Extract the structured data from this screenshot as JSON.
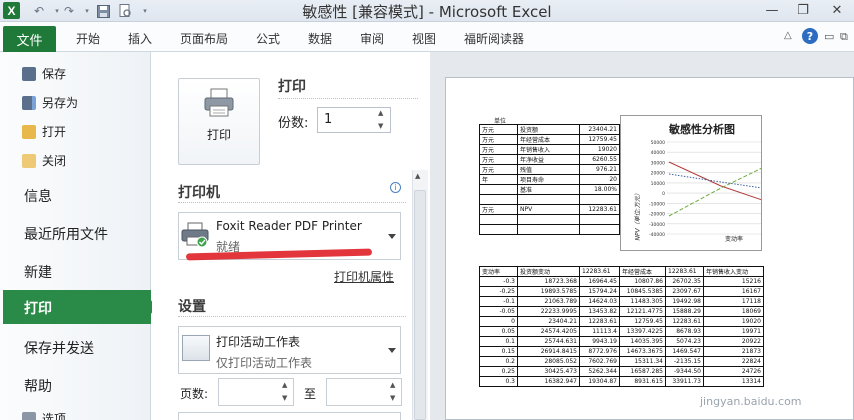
{
  "window": {
    "title": "敏感性 [兼容模式] - Microsoft Excel",
    "app_icon_letter": "X"
  },
  "ribbon": {
    "file_tab": "文件",
    "tabs": [
      "开始",
      "插入",
      "页面布局",
      "公式",
      "数据",
      "审阅",
      "视图",
      "福昕阅读器"
    ]
  },
  "backstage_nav": {
    "commands": [
      "保存",
      "另存为",
      "打开",
      "关闭"
    ],
    "items": [
      "信息",
      "最近所用文件",
      "新建",
      "打印",
      "保存并发送",
      "帮助"
    ],
    "bottom": "选项",
    "selected": "打印"
  },
  "print_panel": {
    "print_heading": "打印",
    "print_button_label": "打印",
    "copies_label": "份数:",
    "copies_value": "1",
    "printer_heading": "打印机",
    "printer_name": "Foxit Reader PDF Printer",
    "printer_status": "就绪",
    "printer_properties_link": "打印机属性",
    "settings_heading": "设置",
    "print_scope_title": "打印活动工作表",
    "print_scope_desc": "仅打印活动工作表",
    "pages_label": "页数:",
    "pages_to_label": "至"
  },
  "preview": {
    "unit_label": "单位",
    "top_table": [
      [
        "万元",
        "投资额",
        "23404.21"
      ],
      [
        "万元",
        "年经营成本",
        "12759.45"
      ],
      [
        "万元",
        "年销售收入",
        "19020"
      ],
      [
        "万元",
        "年净收益",
        "6260.55"
      ],
      [
        "万元",
        "残值",
        "976.21"
      ],
      [
        "年",
        "项目寿命",
        "20"
      ],
      [
        "",
        "基准",
        "18.00%"
      ],
      [
        "",
        "",
        ""
      ],
      [
        "万元",
        "NPV",
        "12283.61"
      ],
      [
        "",
        "",
        ""
      ],
      [
        "",
        "",
        ""
      ]
    ],
    "chart": {
      "title": "敏感性分析图",
      "ylabel": "NPV（单位:万元）",
      "xlabel": "变动率",
      "yticks": [
        "50000",
        "40000",
        "30000",
        "20000",
        "10000",
        "0",
        "-10000",
        "-20000",
        "-30000",
        "-40000"
      ]
    },
    "sens_header": [
      "变动率",
      "投资额变动",
      "12283.61",
      "年经营成本",
      "12283.61",
      "年销售收入变动"
    ],
    "sens_rows": [
      [
        "-0.3",
        "18723.368",
        "16964.45",
        "10807.86",
        "26702.35",
        "15216"
      ],
      [
        "-0.25",
        "19893.5785",
        "15794.24",
        "10845.5385",
        "23097.67",
        "16167"
      ],
      [
        "-0.1",
        "21063.789",
        "14624.03",
        "11483.305",
        "19492.98",
        "17118"
      ],
      [
        "-0.05",
        "22233.9995",
        "13453.82",
        "12121.4775",
        "15888.29",
        "18069"
      ],
      [
        "0",
        "23404.21",
        "12283.61",
        "12759.45",
        "12283.61",
        "19020"
      ],
      [
        "0.05",
        "24574.4205",
        "11113.4",
        "13397.4225",
        "8678.93",
        "19971"
      ],
      [
        "0.1",
        "25744.631",
        "9943.19",
        "14035.395",
        "5074.23",
        "20922"
      ],
      [
        "0.15",
        "26914.8415",
        "8772.976",
        "14673.3675",
        "1469.547",
        "21873"
      ],
      [
        "0.2",
        "28085.052",
        "7602.769",
        "15311.34",
        "-2135.15",
        "22824"
      ],
      [
        "0.25",
        "30425.473",
        "5262.344",
        "16587.285",
        "-9344.50",
        "24726"
      ],
      [
        "0.3",
        "16382.947",
        "19304.87",
        "8931.615",
        "33911.73",
        "13314"
      ]
    ]
  },
  "watermark": "jingyan.baidu.com",
  "colors": {
    "file_green": "#1f7a3a",
    "nav_selected": "#2a8a47",
    "strike_red": "#e0252b"
  }
}
